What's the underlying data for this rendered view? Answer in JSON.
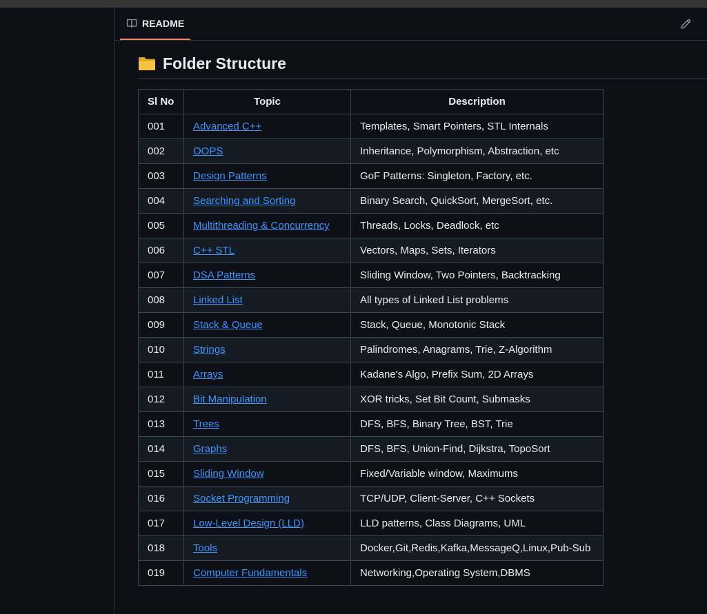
{
  "readme_tab": {
    "label": "README"
  },
  "section": {
    "title": "Folder Structure"
  },
  "table": {
    "headers": {
      "sl_no": "Sl No",
      "topic": "Topic",
      "description": "Description"
    },
    "rows": [
      {
        "sl_no": "001",
        "topic": "Advanced C++",
        "description": "Templates, Smart Pointers, STL Internals"
      },
      {
        "sl_no": "002",
        "topic": "OOPS",
        "description": "Inheritance, Polymorphism, Abstraction, etc"
      },
      {
        "sl_no": "003",
        "topic": "Design Patterns",
        "description": "GoF Patterns: Singleton, Factory, etc."
      },
      {
        "sl_no": "004",
        "topic": "Searching and Sorting",
        "description": "Binary Search, QuickSort, MergeSort, etc."
      },
      {
        "sl_no": "005",
        "topic": "Multithreading & Concurrency",
        "description": "Threads, Locks, Deadlock, etc"
      },
      {
        "sl_no": "006",
        "topic": "C++ STL",
        "description": "Vectors, Maps, Sets, Iterators"
      },
      {
        "sl_no": "007",
        "topic": "DSA Patterns",
        "description": "Sliding Window, Two Pointers, Backtracking"
      },
      {
        "sl_no": "008",
        "topic": "Linked List",
        "description": "All types of Linked List problems"
      },
      {
        "sl_no": "009",
        "topic": "Stack & Queue",
        "description": "Stack, Queue, Monotonic Stack"
      },
      {
        "sl_no": "010",
        "topic": "Strings",
        "description": "Palindromes, Anagrams, Trie, Z-Algorithm"
      },
      {
        "sl_no": "011",
        "topic": "Arrays",
        "description": "Kadane's Algo, Prefix Sum, 2D Arrays"
      },
      {
        "sl_no": "012",
        "topic": "Bit Manipulation",
        "description": "XOR tricks, Set Bit Count, Submasks"
      },
      {
        "sl_no": "013",
        "topic": "Trees",
        "description": "DFS, BFS, Binary Tree, BST, Trie"
      },
      {
        "sl_no": "014",
        "topic": "Graphs",
        "description": "DFS, BFS, Union-Find, Dijkstra, TopoSort"
      },
      {
        "sl_no": "015",
        "topic": "Sliding Window",
        "description": "Fixed/Variable window, Maximums"
      },
      {
        "sl_no": "016",
        "topic": "Socket Programming",
        "description": "TCP/UDP, Client-Server, C++ Sockets"
      },
      {
        "sl_no": "017",
        "topic": "Low-Level Design (LLD)",
        "description": "LLD patterns, Class Diagrams, UML"
      },
      {
        "sl_no": "018",
        "topic": "Tools",
        "description": "Docker,Git,Redis,Kafka,MessageQ,Linux,Pub-Sub"
      },
      {
        "sl_no": "019",
        "topic": "Computer Fundamentals",
        "description": "Networking,Operating System,DBMS"
      }
    ]
  },
  "icons": {
    "tab": "book-icon",
    "edit": "pencil-icon",
    "heading": "folder-icon"
  },
  "colors": {
    "background": "#0d1117",
    "alt_row": "#151b23",
    "border": "#3d444d",
    "link": "#4493f8",
    "tab_underline": "#f78166",
    "folder": "#f4c542"
  }
}
